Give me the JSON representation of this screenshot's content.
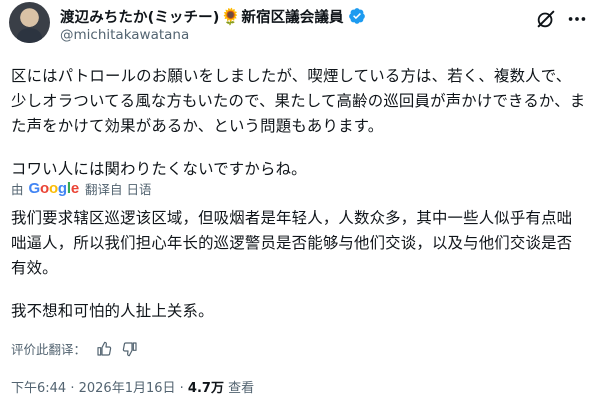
{
  "author": {
    "display_name": "渡辺みちたか(ミッチー)",
    "flower_emoji": "🌻",
    "title": "新宿区議会議員",
    "handle": "@michitakawatana",
    "verified_color": "#1d9bf0"
  },
  "tweet": {
    "paragraph1": "区にはパトロールのお願いをしましたが、喫煙している方は、若く、複数人で、少しオラついてる風な方もいたので、果たして高齢の巡回員が声かけできるか、また声をかけて効果があるか、という問題もあります。",
    "paragraph2": "コワい人には関わりたくないですからね。"
  },
  "translation": {
    "by_label": "由",
    "provider": "Google",
    "from_label": "翻译自 日语",
    "paragraph1": "我们要求辖区巡逻该区域，但吸烟者是年轻人，人数众多，其中一些人似乎有点咄咄逼人，所以我们担心年长的巡逻警员是否能够与他们交谈，以及与他们交谈是否有效。",
    "paragraph2": "我不想和可怕的人扯上关系。",
    "rate_label": "评价此翻译："
  },
  "meta": {
    "time": "下午6:44",
    "separator1": " · ",
    "date": "2026年1月16日",
    "separator2": " · ",
    "views_count": "4.7万",
    "views_label": " 查看"
  },
  "icons": {
    "grok": "grok-icon",
    "more": "more-icon",
    "thumbs_up": "thumbs-up-icon",
    "thumbs_down": "thumbs-down-icon"
  }
}
